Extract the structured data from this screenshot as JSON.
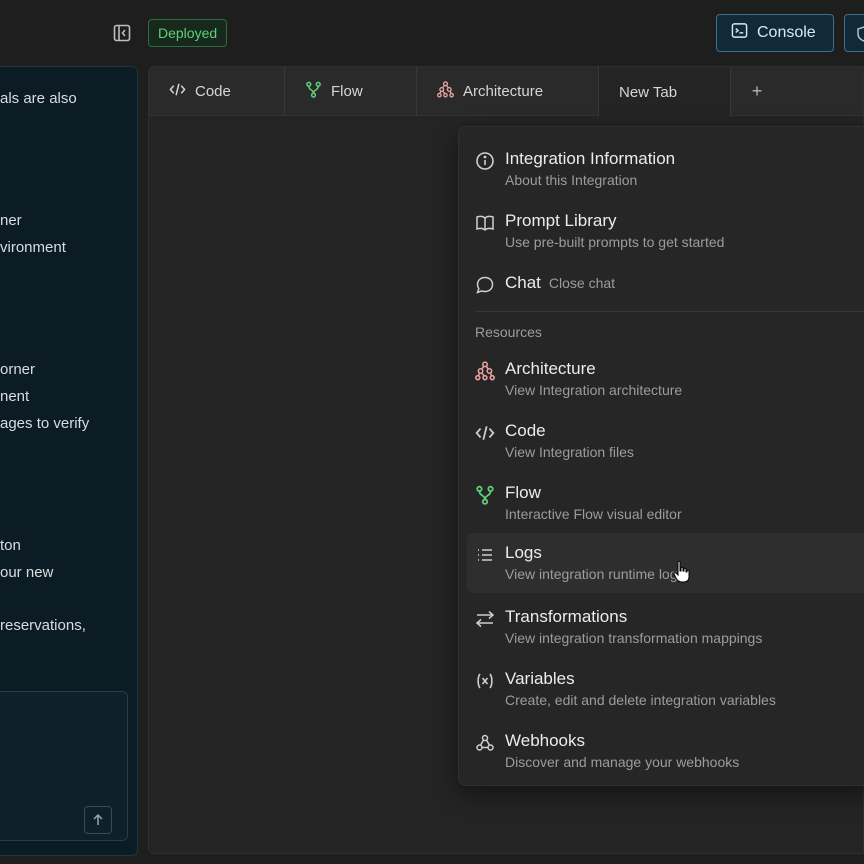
{
  "header": {
    "status_badge": "Deployed",
    "console_label": "Console"
  },
  "chat": {
    "lines": [
      "als are also",
      "ner",
      "vironment",
      "orner",
      "nent",
      "ages to verify",
      "ton",
      "our new",
      "reservations,"
    ]
  },
  "tabs": [
    {
      "label": "Code",
      "icon": "code-icon"
    },
    {
      "label": "Flow",
      "icon": "flow-icon"
    },
    {
      "label": "Architecture",
      "icon": "architecture-icon"
    },
    {
      "label": "New Tab",
      "icon": ""
    }
  ],
  "tab_add_label": "+",
  "menu": {
    "top_items": [
      {
        "title": "Integration Information",
        "subtitle": "About this Integration",
        "icon": "info-icon"
      },
      {
        "title": "Prompt Library",
        "subtitle": "Use pre-built prompts to get started",
        "icon": "book-icon"
      },
      {
        "title": "Chat",
        "subtitle": "Close chat",
        "icon": "chat-icon"
      }
    ],
    "section_label": "Resources",
    "resource_items": [
      {
        "title": "Architecture",
        "subtitle": "View Integration architecture",
        "icon": "architecture-icon"
      },
      {
        "title": "Code",
        "subtitle": "View Integration files",
        "icon": "code-icon"
      },
      {
        "title": "Flow",
        "subtitle": "Interactive Flow visual editor",
        "icon": "flow-icon"
      },
      {
        "title": "Logs",
        "subtitle": "View integration runtime logs",
        "icon": "list-icon"
      },
      {
        "title": "Transformations",
        "subtitle": "View integration transformation mappings",
        "icon": "arrows-icon"
      },
      {
        "title": "Variables",
        "subtitle": "Create, edit and delete integration variables",
        "icon": "variable-icon"
      },
      {
        "title": "Webhooks",
        "subtitle": "Discover and manage your webhooks",
        "icon": "webhook-icon"
      }
    ]
  },
  "colors": {
    "accent_green": "#5fd07a",
    "accent_blue": "#3e6f8e",
    "flow_icon": "#5fd07a",
    "architecture_icon": "#e8a0a0"
  }
}
